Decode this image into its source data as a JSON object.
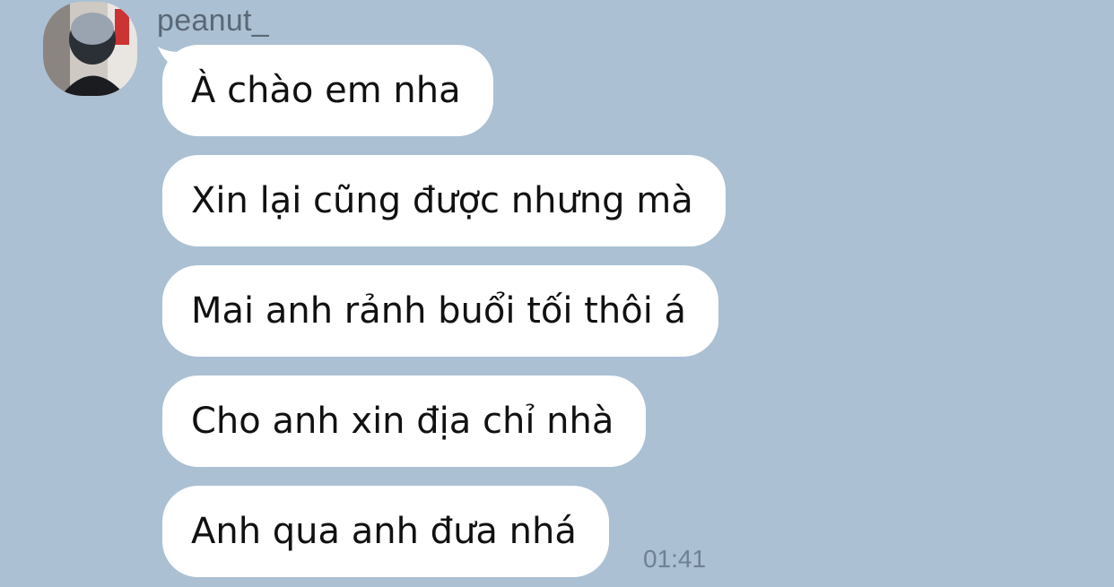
{
  "chat": {
    "background_color": "#abc0d3",
    "sender": {
      "name": "peanut_",
      "avatar": "profile-photo"
    },
    "messages": [
      {
        "text": "À chào em nha"
      },
      {
        "text": "Xin lại cũng được nhưng mà"
      },
      {
        "text": "Mai anh rảnh buổi tối thôi á"
      },
      {
        "text": "Cho anh xin địa chỉ nhà"
      },
      {
        "text": "Anh qua anh đưa nhá"
      }
    ],
    "last_timestamp": "01:41"
  }
}
